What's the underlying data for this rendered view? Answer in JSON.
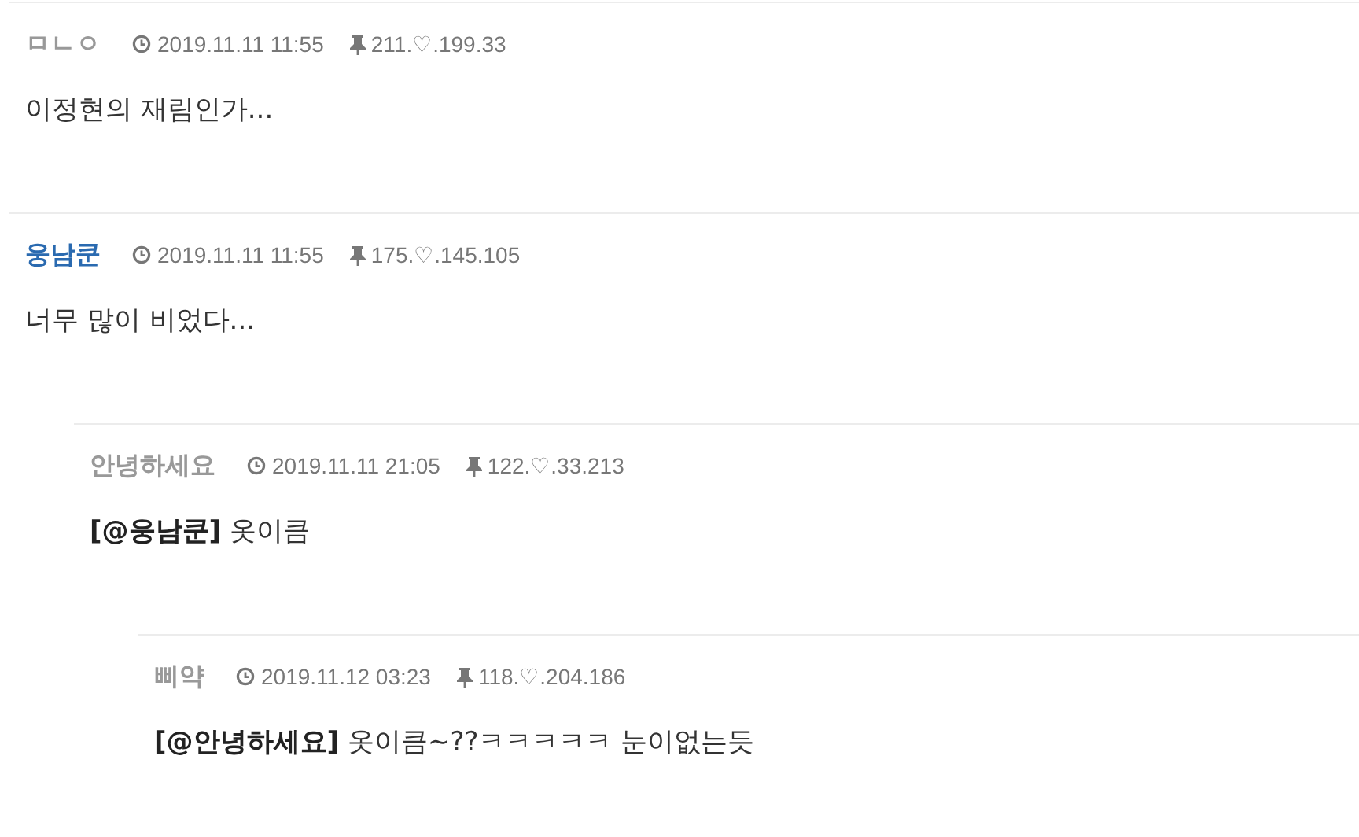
{
  "comments": [
    {
      "author": "ㅁㄴㅇ",
      "member": false,
      "time": "2019.11.11 11:55",
      "ip": "211.♡.199.33",
      "text": "이정현의 재림인가..."
    },
    {
      "author": "웅남쿤",
      "member": true,
      "time": "2019.11.11 11:55",
      "ip": "175.♡.145.105",
      "text": "너무 많이 비었다...",
      "children": [
        {
          "author": "안녕하세요",
          "member": false,
          "time": "2019.11.11 21:05",
          "ip": "122.♡.33.213",
          "text": "**[@웅남쿤]** 옷이큼",
          "children": [
            {
              "author": "삐약",
              "member": false,
              "time": "2019.11.12 03:23",
              "ip": "118.♡.204.186",
              "text": "**[@안녕하세요]** 옷이큼~??ㅋㅋㅋㅋㅋ 눈이없는듯"
            }
          ]
        }
      ]
    }
  ]
}
